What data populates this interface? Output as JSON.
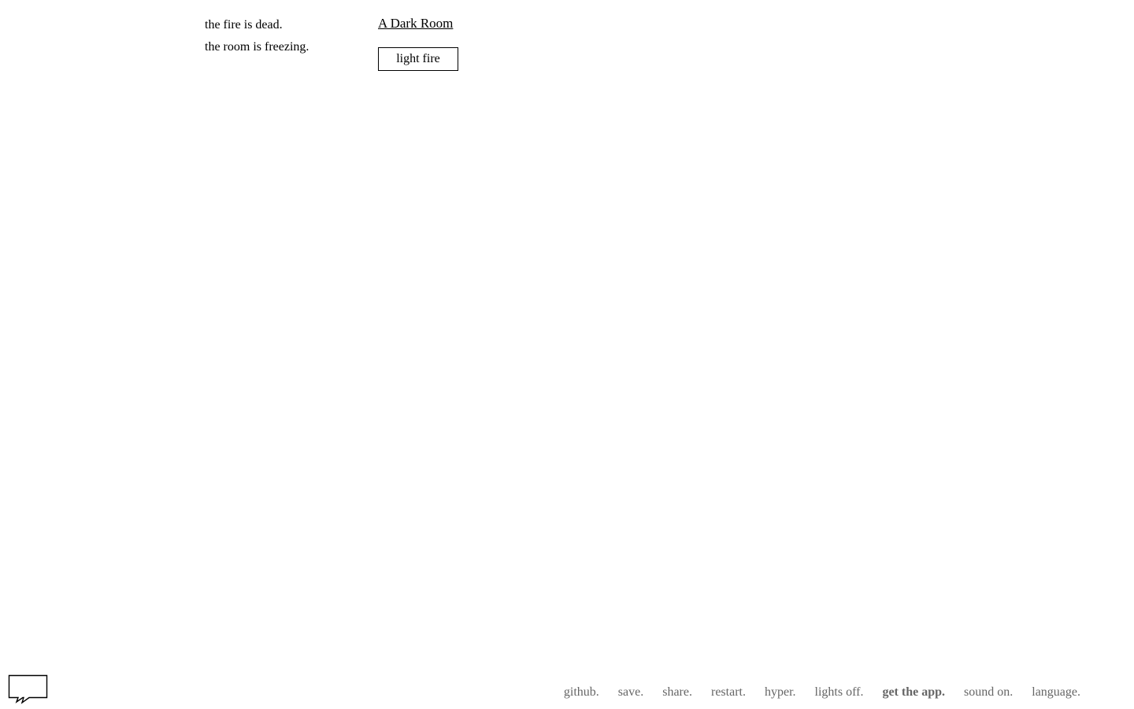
{
  "notifications": [
    "the fire is dead.",
    "the room is freezing."
  ],
  "header": {
    "location": "A Dark Room"
  },
  "actions": {
    "light_fire": "light fire"
  },
  "menu": {
    "github": "github.",
    "save": "save.",
    "share": "share.",
    "restart": "restart.",
    "hyper": "hyper.",
    "lights_off": "lights off.",
    "get_app": "get the app.",
    "sound": "sound on.",
    "language": "language."
  },
  "icons": {
    "bubble": "speech-bubble-icon"
  },
  "colors": {
    "background": "#ffffff",
    "text": "#000000",
    "menu_text": "#666666"
  }
}
